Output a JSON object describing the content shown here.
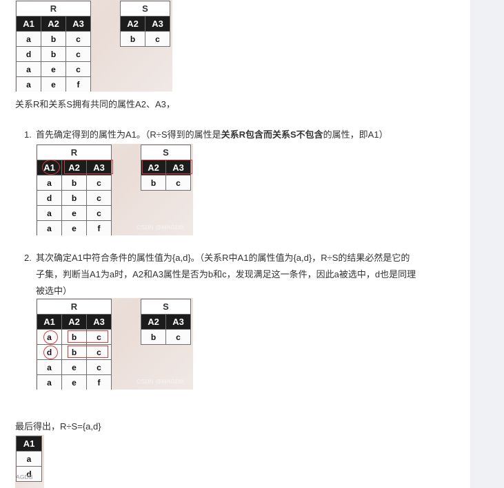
{
  "figure1": {
    "R": {
      "title": "R",
      "headers": [
        "A1",
        "A2",
        "A3"
      ],
      "rows": [
        [
          "a",
          "b",
          "c"
        ],
        [
          "d",
          "b",
          "c"
        ],
        [
          "a",
          "e",
          "c"
        ],
        [
          "a",
          "e",
          "f"
        ]
      ]
    },
    "S": {
      "title": "S",
      "headers": [
        "A2",
        "A3"
      ],
      "rows": [
        [
          "b",
          "c"
        ]
      ]
    }
  },
  "para1": "关系R和关系S拥有共同的属性A2、A3，",
  "steps": [
    {
      "number": "1.",
      "text_parts": [
        {
          "t": "首先确定得到的属性为A1。（R÷S得到的属性是",
          "bold": false
        },
        {
          "t": "关系R包含而关系S不包含",
          "bold": true
        },
        {
          "t": "的属性，即A1）",
          "bold": false
        }
      ],
      "figure": {
        "R": {
          "title": "R",
          "headers": [
            "A1",
            "A2",
            "A3"
          ],
          "rows": [
            [
              "a",
              "b",
              "c"
            ],
            [
              "d",
              "b",
              "c"
            ],
            [
              "a",
              "e",
              "c"
            ],
            [
              "a",
              "e",
              "f"
            ]
          ]
        },
        "S": {
          "title": "S",
          "headers": [
            "A2",
            "A3"
          ],
          "rows": [
            [
              "b",
              "c"
            ]
          ]
        },
        "watermark": "CSDN @MAGDB"
      }
    },
    {
      "number": "2.",
      "lines": [
        "其次确定A1中符合条件的属性值为{a,d}。（关系R中A1的属性值为{a,d}，R÷S的结果必然是它的",
        "子集，判断当A1为a时，A2和A3属性是否为b和c，发现满足这一条件，因此a被选中，d也是同理",
        "被选中）"
      ],
      "figure": {
        "R": {
          "title": "R",
          "headers": [
            "A1",
            "A2",
            "A3"
          ],
          "rows": [
            [
              "a",
              "b",
              "c"
            ],
            [
              "d",
              "b",
              "c"
            ],
            [
              "a",
              "e",
              "c"
            ],
            [
              "a",
              "e",
              "f"
            ]
          ]
        },
        "S": {
          "title": "S",
          "headers": [
            "A2",
            "A3"
          ],
          "rows": [
            [
              "b",
              "c"
            ]
          ]
        },
        "watermark": "CSDN @MAGDB"
      }
    }
  ],
  "final_text": "最后得出，R÷S={a,d}",
  "result": {
    "headers": [
      "A1"
    ],
    "rows": [
      [
        "a"
      ],
      [
        "d"
      ]
    ],
    "watermark": "AGDB"
  }
}
